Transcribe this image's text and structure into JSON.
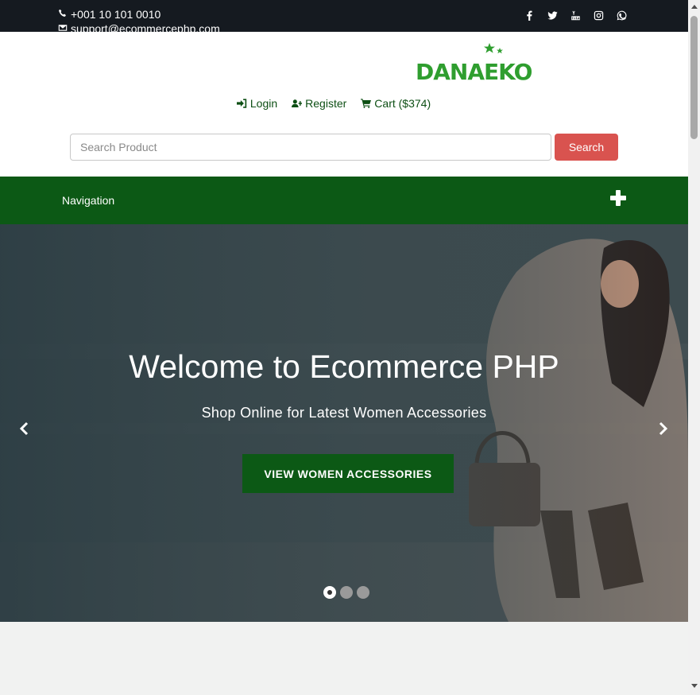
{
  "topbar": {
    "phone": "+001 10 101 0010",
    "email": "support@ecommercephp.com",
    "social_icons": [
      "facebook-icon",
      "twitter-icon",
      "youtube-icon",
      "instagram-icon",
      "whatsapp-icon"
    ]
  },
  "header": {
    "logo_text": "DANAEKO",
    "login": "Login",
    "register": "Register",
    "cart": "Cart ($374)"
  },
  "search": {
    "placeholder": "Search Product",
    "button": "Search"
  },
  "nav": {
    "label": "Navigation"
  },
  "hero": {
    "title": "Welcome to Ecommerce PHP",
    "subtitle": "Shop Online for Latest Women Accessories",
    "button": "VIEW WOMEN ACCESSORIES",
    "slide_count": 3,
    "active_slide": 1
  },
  "colors": {
    "topbar_bg": "#151a20",
    "brand_green": "#0c5915",
    "search_button": "#d9534f",
    "logo_green": "#2f9e2f"
  }
}
